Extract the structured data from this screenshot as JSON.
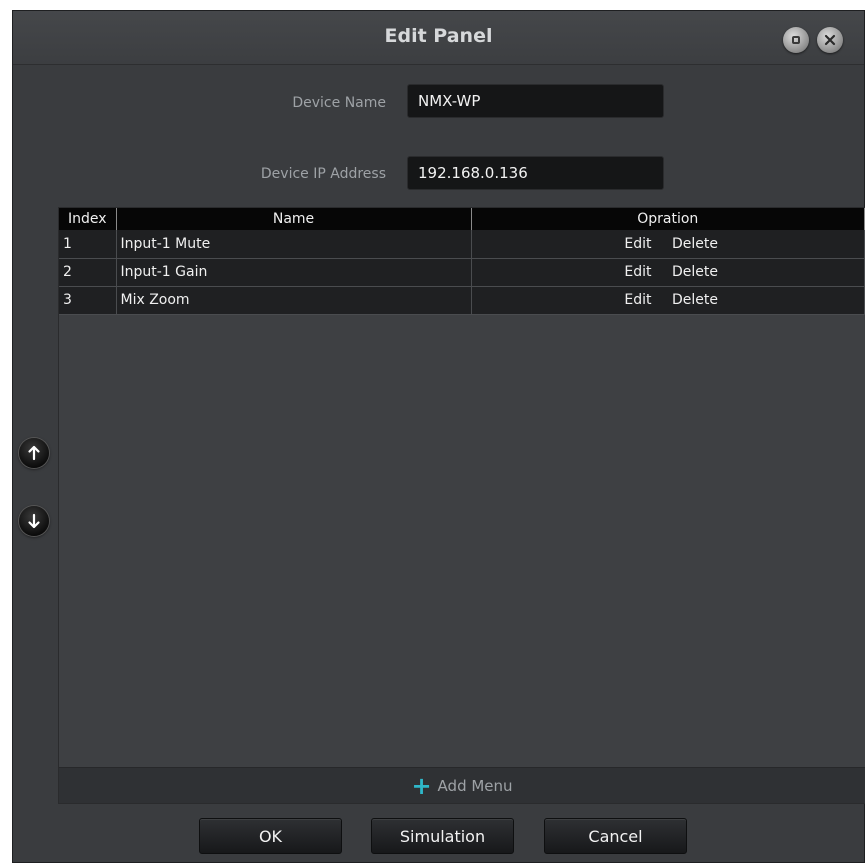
{
  "window": {
    "title": "Edit Panel"
  },
  "form": {
    "device_name_label": "Device Name",
    "device_name_value": "NMX-WP",
    "device_ip_label": "Device IP Address",
    "device_ip_value": "192.168.0.136"
  },
  "table": {
    "headers": [
      "Index",
      "Name",
      "Opration"
    ],
    "rows": [
      {
        "index": "1",
        "name": "Input-1 Mute",
        "edit": "Edit",
        "delete": "Delete"
      },
      {
        "index": "2",
        "name": "Input-1 Gain",
        "edit": "Edit",
        "delete": "Delete"
      },
      {
        "index": "3",
        "name": "Mix Zoom",
        "edit": "Edit",
        "delete": "Delete"
      }
    ]
  },
  "add_menu": {
    "icon": "plus-icon",
    "label": "Add Menu"
  },
  "side_controls": {
    "up_icon": "arrow-up-icon",
    "down_icon": "arrow-down-icon"
  },
  "buttons": {
    "ok": "OK",
    "simulation": "Simulation",
    "cancel": "Cancel"
  },
  "colors": {
    "window_bg": "#3a3c3f",
    "header_bg": "#060606",
    "row_bg": "#1f2022",
    "accent_plus": "#2fb7c9"
  }
}
